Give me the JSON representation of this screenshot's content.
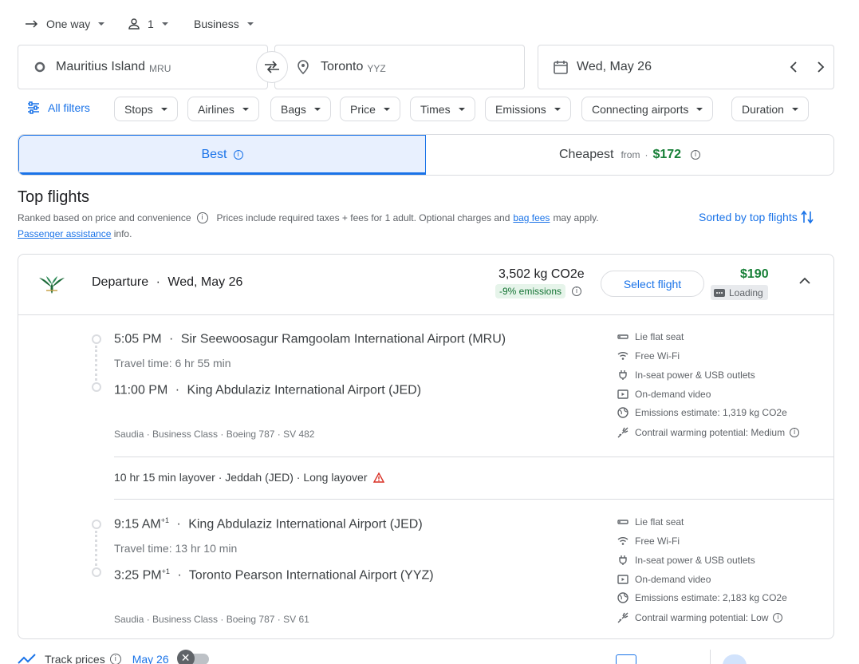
{
  "search": {
    "trip_type": "One way",
    "passengers": "1",
    "cabin": "Business",
    "origin_name": "Mauritius Island",
    "origin_code": "MRU",
    "dest_name": "Toronto",
    "dest_code": "YYZ",
    "date": "Wed, May 26"
  },
  "filters": {
    "all_filters": "All filters",
    "chips": [
      "Stops",
      "Airlines",
      "Bags",
      "Price",
      "Times",
      "Emissions",
      "Connecting airports",
      "Duration"
    ]
  },
  "tabs": {
    "best": "Best",
    "cheapest": "Cheapest",
    "cheapest_from": "from",
    "cheapest_price": "$172"
  },
  "results": {
    "title": "Top flights",
    "ranked_text": "Ranked based on price and convenience",
    "prices_text_a": "Prices include required taxes + fees for 1 adult. Optional charges and",
    "bag_fees": "bag fees",
    "prices_text_b": "may apply.",
    "passenger_assistance": "Passenger assistance",
    "info": "info.",
    "sorted": "Sorted by top flights"
  },
  "flight": {
    "departure_label": "Departure",
    "departure_date": "Wed, May 26",
    "emissions": "3,502 kg CO2e",
    "emissions_delta": "-9% emissions",
    "select": "Select flight",
    "price": "$190",
    "loading": "Loading",
    "segments": [
      {
        "dep_time": "5:05 PM",
        "dep_sup": "",
        "dep_airport": "Sir Seewoosagur Ramgoolam International Airport (MRU)",
        "travel": "Travel time: 6 hr 55 min",
        "arr_time": "11:00 PM",
        "arr_sup": "",
        "arr_airport": "King Abdulaziz International Airport (JED)",
        "meta": "Saudia · Business Class · Boeing 787 · SV 482",
        "amenities": [
          "Lie flat seat",
          "Free Wi-Fi",
          "In-seat power & USB outlets",
          "On-demand video",
          "Emissions estimate: 1,319 kg CO2e",
          "Contrail warming potential: Medium"
        ]
      },
      {
        "dep_time": "9:15 AM",
        "dep_sup": "+1",
        "dep_airport": "King Abdulaziz International Airport (JED)",
        "travel": "Travel time: 13 hr 10 min",
        "arr_time": "3:25 PM",
        "arr_sup": "+1",
        "arr_airport": "Toronto Pearson International Airport (YYZ)",
        "meta": "Saudia · Business Class · Boeing 787 · SV 61",
        "amenities": [
          "Lie flat seat",
          "Free Wi-Fi",
          "In-seat power & USB outlets",
          "On-demand video",
          "Emissions estimate: 2,183 kg CO2e",
          "Contrail warming potential: Low"
        ]
      }
    ],
    "layover": "10 hr 15 min layover · Jeddah (JED) · Long layover"
  },
  "footer": {
    "track": "Track prices",
    "track_date": "May 26"
  },
  "colors": {
    "accent": "#1a73e8",
    "price_green": "#188038",
    "emissions_bg": "#e6f4ea",
    "warning_red": "#d93025"
  }
}
